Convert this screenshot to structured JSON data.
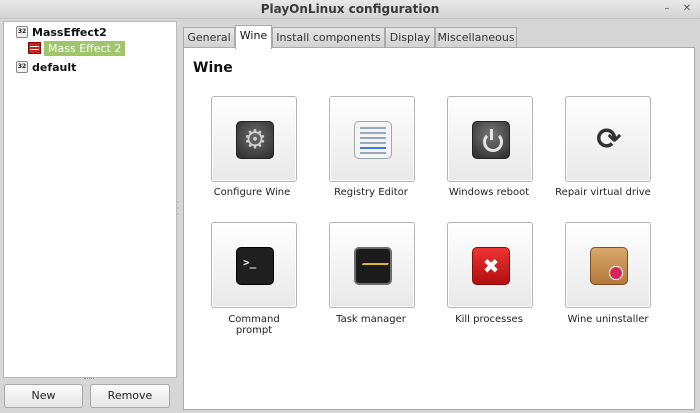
{
  "window": {
    "title": "PlayOnLinux configuration",
    "minimize_glyph": "–",
    "close_glyph": "✕"
  },
  "sidebar": {
    "badge": "32",
    "items": [
      {
        "label": "MassEffect2",
        "type": "prefix"
      },
      {
        "label": "Mass Effect 2",
        "type": "game",
        "selected": true
      },
      {
        "label": "default",
        "type": "prefix"
      }
    ],
    "new_label": "New",
    "remove_label": "Remove"
  },
  "tabs": [
    {
      "label": "General",
      "active": false
    },
    {
      "label": "Wine",
      "active": true
    },
    {
      "label": "Install components",
      "active": false
    },
    {
      "label": "Display",
      "active": false
    },
    {
      "label": "Miscellaneous",
      "active": false
    }
  ],
  "section": {
    "heading": "Wine"
  },
  "tools": [
    {
      "label": "Configure Wine",
      "icon": "gear-icon"
    },
    {
      "label": "Registry Editor",
      "icon": "registry-icon"
    },
    {
      "label": "Windows reboot",
      "icon": "power-icon"
    },
    {
      "label": "Repair virtual drive",
      "icon": "refresh-icon"
    },
    {
      "label": "Command prompt",
      "icon": "terminal-icon"
    },
    {
      "label": "Task manager",
      "icon": "task-monitor-icon"
    },
    {
      "label": "Kill processes",
      "icon": "kill-icon"
    },
    {
      "label": "Wine uninstaller",
      "icon": "uninstall-package-icon"
    }
  ],
  "colors": {
    "selection": "#9fc66b",
    "kill_red": "#d62a2a"
  }
}
